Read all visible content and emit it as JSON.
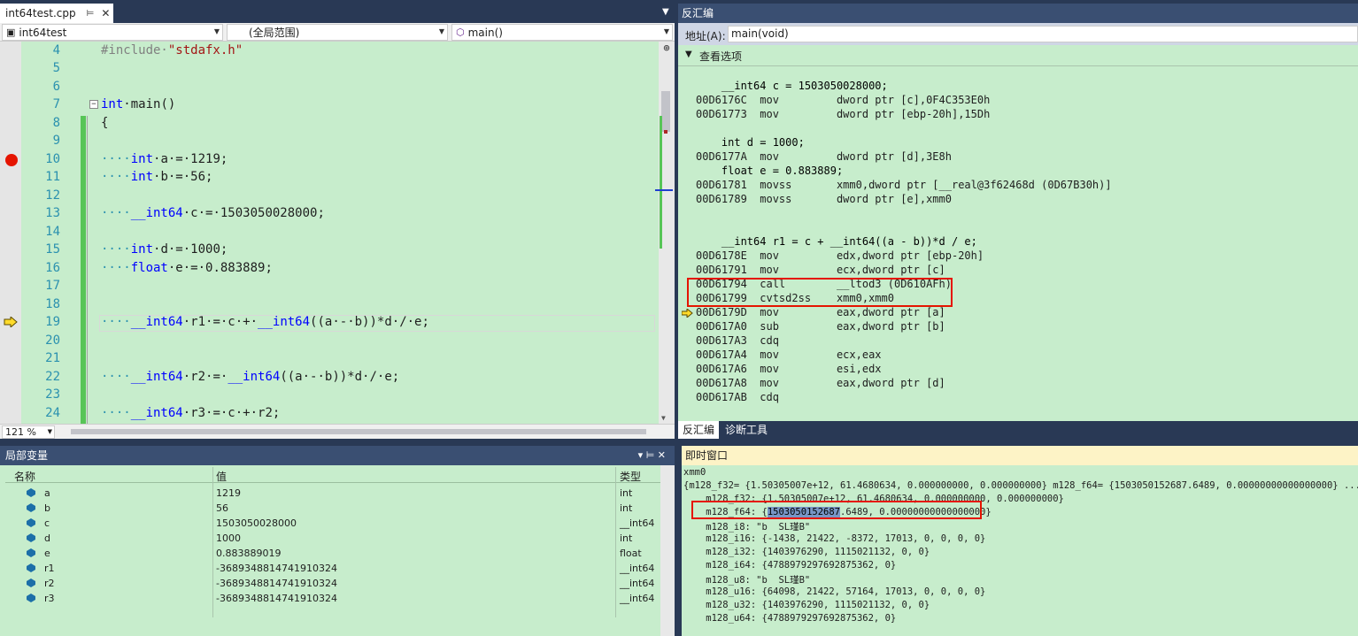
{
  "editor": {
    "tab_title": "int64test.cpp",
    "tab_pin": "⊨",
    "tab_close": "✕",
    "tabs_dropdown": "▼",
    "nav_project": "int64test",
    "nav_scope": "(全局范围)",
    "nav_function": "main()",
    "zoom": "121 %",
    "lines": [
      {
        "n": "4"
      },
      {
        "n": "5"
      },
      {
        "n": "6"
      },
      {
        "n": "7"
      },
      {
        "n": "8"
      },
      {
        "n": "9"
      },
      {
        "n": "10"
      },
      {
        "n": "11"
      },
      {
        "n": "12"
      },
      {
        "n": "13"
      },
      {
        "n": "14"
      },
      {
        "n": "15"
      },
      {
        "n": "16"
      },
      {
        "n": "17"
      },
      {
        "n": "18"
      },
      {
        "n": "19"
      },
      {
        "n": "20"
      },
      {
        "n": "21"
      },
      {
        "n": "22"
      },
      {
        "n": "23"
      },
      {
        "n": "24"
      }
    ],
    "code": {
      "l4_pp": "#include·",
      "l4_str": "\"stdafx.h\"",
      "l7_kw": "int",
      "l7_rest": "·main()",
      "l8": "{",
      "l10_dots": "····",
      "l10_kw": "int",
      "l10_rest": "·a·=·1219;",
      "l11_dots": "····",
      "l11_kw": "int",
      "l11_rest": "·b·=·56;",
      "l13_dots": "····",
      "l13_kw": "__int64",
      "l13_rest": "·c·=·1503050028000;",
      "l15_dots": "····",
      "l15_kw": "int",
      "l15_rest": "·d·=·1000;",
      "l16_dots": "····",
      "l16_kw": "float",
      "l16_rest": "·e·=·0.883889;",
      "l19_dots": "····",
      "l19_kw": "__int64",
      "l19_mid": "·r1·=·c·+·",
      "l19_kw2": "__int64",
      "l19_rest": "((a·-·b))*d·/·e;",
      "l22_dots": "····",
      "l22_kw": "__int64",
      "l22_mid": "·r2·=·",
      "l22_kw2": "__int64",
      "l22_rest": "((a·-·b))*d·/·e;",
      "l24_dots": "····",
      "l24_kw": "__int64",
      "l24_rest": "·r3·=·c·+·r2;"
    }
  },
  "disasm": {
    "title": "反汇编",
    "addr_label": "地址(A):",
    "addr_value": "main(void)",
    "view_options": "查看选项",
    "lines": [
      "    __int64 c = 1503050028000;",
      "00D6176C  mov         dword ptr [c],0F4C353E0h",
      "00D61773  mov         dword ptr [ebp-20h],15Dh",
      "",
      "    int d = 1000;",
      "00D6177A  mov         dword ptr [d],3E8h",
      "    float e = 0.883889;",
      "00D61781  movss       xmm0,dword ptr [__real@3f62468d (0D67B30h)]",
      "00D61789  movss       dword ptr [e],xmm0",
      "",
      "",
      "    __int64 r1 = c + __int64((a - b))*d / e;",
      "00D6178E  mov         edx,dword ptr [ebp-20h]",
      "00D61791  mov         ecx,dword ptr [c]",
      "00D61794  call        __ltod3 (0D610AFh)",
      "00D61799  cvtsd2ss    xmm0,xmm0",
      "00D6179D  mov         eax,dword ptr [a]",
      "00D617A0  sub         eax,dword ptr [b]",
      "00D617A3  cdq",
      "00D617A4  mov         ecx,eax",
      "00D617A6  mov         esi,edx",
      "00D617A8  mov         eax,dword ptr [d]",
      "00D617AB  cdq"
    ],
    "tab_disasm": "反汇编",
    "tab_diag": "诊断工具"
  },
  "locals": {
    "title": "局部变量",
    "controls": "▾  ⊨  ✕",
    "col_name": "名称",
    "col_value": "值",
    "col_type": "类型",
    "rows": [
      {
        "name": "a",
        "value": "1219",
        "type": "int"
      },
      {
        "name": "b",
        "value": "56",
        "type": "int"
      },
      {
        "name": "c",
        "value": "1503050028000",
        "type": "__int64"
      },
      {
        "name": "d",
        "value": "1000",
        "type": "int"
      },
      {
        "name": "e",
        "value": "0.883889019",
        "type": "float"
      },
      {
        "name": "r1",
        "value": "-3689348814741910324",
        "type": "__int64"
      },
      {
        "name": "r2",
        "value": "-3689348814741910324",
        "type": "__int64"
      },
      {
        "name": "r3",
        "value": "-3689348814741910324",
        "type": "__int64"
      }
    ]
  },
  "immediate": {
    "title": "即时窗口",
    "lines": [
      "xmm0",
      "{m128_f32= {1.50305007e+12, 61.4680634, 0.000000000, 0.000000000} m128_f64= {1503050152687.6489, 0.00000000000000000} ...}",
      "    m128_f32: {1.50305007e+12, 61.4680634, 0.000000000, 0.000000000}",
      "",
      "    m128_i8: \"b  SL瑾B\"",
      "    m128_i16: {-1438, 21422, -8372, 17013, 0, 0, 0, 0}",
      "    m128_i32: {1403976290, 1115021132, 0, 0}",
      "    m128_i64: {4788979297692875362, 0}",
      "    m128_u8: \"b  SL瑾B\"",
      "    m128_u16: {64098, 21422, 57164, 17013, 0, 0, 0, 0}",
      "    m128_u32: {1403976290, 1115021132, 0, 0}",
      "    m128_u64: {4788979297692875362, 0}"
    ],
    "f64_prefix": "    m128_f64: {",
    "f64_selected": "1503050152687",
    "f64_suffix": ".6489, 0.00000000000000000}"
  }
}
